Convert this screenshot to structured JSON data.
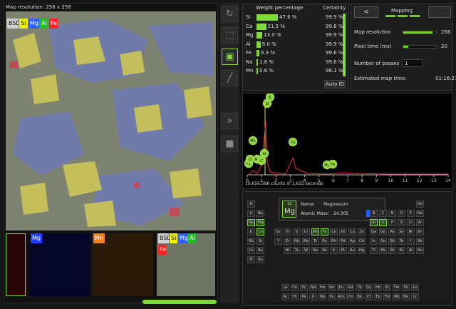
{
  "map": {
    "title": "Map resolution: 256 x 256",
    "chips": [
      "BSD",
      "Si",
      "Mg",
      "Al",
      "Fe"
    ],
    "chip_colors": [
      "#d0d0d0",
      "#f0f010",
      "#3060ff",
      "#20c020",
      "#ff2020"
    ]
  },
  "thumbnails": [
    {
      "label": "",
      "color": "#a01020"
    },
    {
      "label": "Mg",
      "color": "#2040ff"
    },
    {
      "label": "Mn",
      "color": "#f08020"
    },
    {
      "label": "",
      "color": "#888"
    }
  ],
  "thumb_composite_chips": [
    "BSD",
    "Si",
    "Mg",
    "Al",
    "Fe"
  ],
  "progress": 1.0,
  "toolbar": [
    "refresh-icon",
    "select-icon",
    "save-icon",
    "line-icon",
    "forward-icon",
    "stop-icon"
  ],
  "weight": {
    "title": "Weight percentage",
    "certainty_title": "Certainty",
    "rows": [
      {
        "el": "Si",
        "pct": "47.6 %",
        "v": 47.6,
        "cert": "99.9 %"
      },
      {
        "el": "Ca",
        "pct": "21.5 %",
        "v": 21.5,
        "cert": "99.8 %"
      },
      {
        "el": "Mg",
        "pct": "13.0 %",
        "v": 13.0,
        "cert": "99.9 %"
      },
      {
        "el": "Al",
        "pct": "9.0 %",
        "v": 9.0,
        "cert": "99.9 %"
      },
      {
        "el": "Fe",
        "pct": "6.3 %",
        "v": 6.3,
        "cert": "99.6 %"
      },
      {
        "el": "Na",
        "pct": "1.8 %",
        "v": 1.8,
        "cert": "99.6 %"
      },
      {
        "el": "Mn",
        "pct": "0.8 %",
        "v": 0.8,
        "cert": "98.1 %"
      }
    ],
    "auto_id": "Auto ID"
  },
  "mapping": {
    "title": "Mapping",
    "prev": "<",
    "settings": [
      {
        "label": "Map resolution",
        "value": "256",
        "level": 0.9
      },
      {
        "label": "Pixel time (ms)",
        "value": "20",
        "level": 0.15
      }
    ],
    "passes_label": "Number of passes",
    "passes_value": "1",
    "estimated_label": "Estimated map time:",
    "estimated_value": "01:16:27"
  },
  "spectrum": {
    "footer": "10,656,586 counts in 1,615 seconds",
    "ticks": [
      "0",
      "1",
      "2",
      "3",
      "4",
      "5",
      "6",
      "7",
      "8",
      "9",
      "10",
      "11",
      "12",
      "13",
      "14"
    ],
    "peaks": [
      "Mn",
      "Mg",
      "Si",
      "K",
      "Ca",
      "Al",
      "Fe",
      "O",
      "C",
      "Mg",
      "Fe"
    ]
  },
  "periodic": {
    "selected_number": "12",
    "selected_symbol": "Mg",
    "name_label": "Name:",
    "name_value": "Magnesium",
    "mass_label": "Atomic Mass:",
    "mass_value": "24.305",
    "swatch": "#2060ff",
    "rows": [
      [
        "H",
        "",
        "",
        "",
        "",
        "",
        "",
        "",
        "",
        "",
        "",
        "",
        "",
        "",
        "",
        "",
        "",
        "He"
      ],
      [
        "Li",
        "Be",
        "",
        "",
        "",
        "",
        "",
        "",
        "",
        "",
        "",
        "",
        "B",
        "C",
        "N",
        "O",
        "F",
        "Ne"
      ],
      [
        "Na",
        "Mg",
        "",
        "",
        "",
        "",
        "",
        "",
        "",
        "",
        "",
        "",
        "Al",
        "Si",
        "P",
        "S",
        "Cl",
        "Ar"
      ],
      [
        "K",
        "Ca",
        "Sc",
        "Ti",
        "V",
        "Cr",
        "Mn",
        "Fe",
        "Co",
        "Ni",
        "Cu",
        "Zn",
        "Ga",
        "Ge",
        "As",
        "Se",
        "Br",
        "Kr"
      ],
      [
        "Rb",
        "Sr",
        "Y",
        "Zr",
        "Nb",
        "Mo",
        "Tc",
        "Ru",
        "Rh",
        "Pd",
        "Ag",
        "Cd",
        "In",
        "Sn",
        "Sb",
        "Te",
        "I",
        "Xe"
      ],
      [
        "Cs",
        "Ba",
        "",
        "Hf",
        "Ta",
        "W",
        "Re",
        "Os",
        "Ir",
        "Pt",
        "Au",
        "Hg",
        "Tl",
        "Pb",
        "Bi",
        "Po",
        "At",
        "Rn"
      ],
      [
        "Fr",
        "Ra",
        "",
        "",
        "",
        "",
        "",
        "",
        "",
        "",
        "",
        "",
        "",
        "",
        "",
        "",
        "",
        ""
      ]
    ],
    "lanth": [
      "La",
      "Ce",
      "Pr",
      "Nd",
      "Pm",
      "Sm",
      "Eu",
      "Gd",
      "Tb",
      "Dy",
      "Ho",
      "Er",
      "Tm",
      "Yb",
      "Lu"
    ],
    "actin": [
      "Ac",
      "Th",
      "Pa",
      "U",
      "Np",
      "Pu",
      "Am",
      "Cm",
      "Bk",
      "Cf",
      "Es",
      "Fm",
      "Md",
      "No",
      "Lr"
    ],
    "highlighted": [
      "Na",
      "Mg",
      "Al",
      "Si",
      "Ca",
      "Mn",
      "Fe"
    ]
  }
}
